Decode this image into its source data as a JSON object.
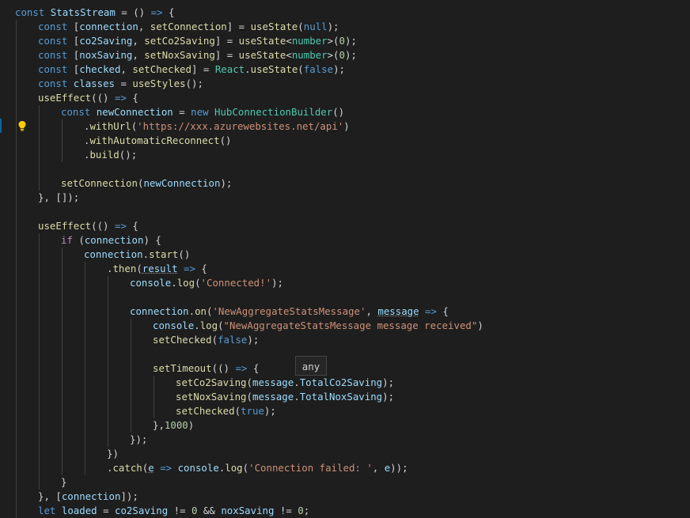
{
  "editor": {
    "lines": [
      {
        "indent": 0,
        "tokens": [
          [
            "k",
            "const"
          ],
          [
            "p",
            " "
          ],
          [
            "v",
            "StatsStream"
          ],
          [
            "p",
            " = () "
          ],
          [
            "k",
            "=>"
          ],
          [
            "p",
            " {"
          ]
        ]
      },
      {
        "indent": 1,
        "tokens": [
          [
            "k",
            "const"
          ],
          [
            "p",
            " ["
          ],
          [
            "v",
            "connection"
          ],
          [
            "p",
            ", "
          ],
          [
            "f",
            "setConnection"
          ],
          [
            "p",
            "] = "
          ],
          [
            "f",
            "useState"
          ],
          [
            "p",
            "("
          ],
          [
            "k",
            "null"
          ],
          [
            "p",
            ");"
          ]
        ]
      },
      {
        "indent": 1,
        "tokens": [
          [
            "k",
            "const"
          ],
          [
            "p",
            " ["
          ],
          [
            "v",
            "co2Saving"
          ],
          [
            "p",
            ", "
          ],
          [
            "f",
            "setCo2Saving"
          ],
          [
            "p",
            "] = "
          ],
          [
            "f",
            "useState"
          ],
          [
            "p",
            "<"
          ],
          [
            "t",
            "number"
          ],
          [
            "p",
            ">("
          ],
          [
            "n",
            "0"
          ],
          [
            "p",
            ");"
          ]
        ]
      },
      {
        "indent": 1,
        "tokens": [
          [
            "k",
            "const"
          ],
          [
            "p",
            " ["
          ],
          [
            "v",
            "noxSaving"
          ],
          [
            "p",
            ", "
          ],
          [
            "f",
            "setNoxSaving"
          ],
          [
            "p",
            "] = "
          ],
          [
            "f",
            "useState"
          ],
          [
            "p",
            "<"
          ],
          [
            "t",
            "number"
          ],
          [
            "p",
            ">("
          ],
          [
            "n",
            "0"
          ],
          [
            "p",
            ");"
          ]
        ]
      },
      {
        "indent": 1,
        "tokens": [
          [
            "k",
            "const"
          ],
          [
            "p",
            " ["
          ],
          [
            "v",
            "checked"
          ],
          [
            "p",
            ", "
          ],
          [
            "f",
            "setChecked"
          ],
          [
            "p",
            "] = "
          ],
          [
            "t",
            "React"
          ],
          [
            "p",
            "."
          ],
          [
            "f",
            "useState"
          ],
          [
            "p",
            "("
          ],
          [
            "k",
            "false"
          ],
          [
            "p",
            ");"
          ]
        ]
      },
      {
        "indent": 1,
        "tokens": [
          [
            "k",
            "const"
          ],
          [
            "p",
            " "
          ],
          [
            "v",
            "classes"
          ],
          [
            "p",
            " = "
          ],
          [
            "f",
            "useStyles"
          ],
          [
            "p",
            "();"
          ]
        ]
      },
      {
        "indent": 1,
        "tokens": [
          [
            "f",
            "useEffect"
          ],
          [
            "p",
            "(() "
          ],
          [
            "k",
            "=>"
          ],
          [
            "p",
            " {"
          ]
        ]
      },
      {
        "indent": 2,
        "tokens": [
          [
            "k",
            "const"
          ],
          [
            "p",
            " "
          ],
          [
            "v",
            "newConnection"
          ],
          [
            "p",
            " = "
          ],
          [
            "k",
            "new"
          ],
          [
            "p",
            " "
          ],
          [
            "t",
            "HubConnectionBuilder"
          ],
          [
            "p",
            "()"
          ]
        ]
      },
      {
        "indent": 3,
        "tokens": [
          [
            "p",
            "."
          ],
          [
            "f",
            "withUrl"
          ],
          [
            "p",
            "("
          ],
          [
            "s",
            "'https://xxx.azurewebsites.net/api'"
          ],
          [
            "p",
            ")"
          ]
        ],
        "active": true
      },
      {
        "indent": 3,
        "tokens": [
          [
            "p",
            "."
          ],
          [
            "f",
            "withAutomaticReconnect"
          ],
          [
            "p",
            "()"
          ]
        ]
      },
      {
        "indent": 3,
        "tokens": [
          [
            "p",
            "."
          ],
          [
            "f",
            "build"
          ],
          [
            "p",
            "();"
          ]
        ]
      },
      {
        "indent": 2,
        "tokens": []
      },
      {
        "indent": 2,
        "tokens": [
          [
            "f",
            "setConnection"
          ],
          [
            "p",
            "("
          ],
          [
            "v",
            "newConnection"
          ],
          [
            "p",
            ");"
          ]
        ]
      },
      {
        "indent": 1,
        "tokens": [
          [
            "p",
            "}, []);"
          ]
        ]
      },
      {
        "indent": 1,
        "tokens": []
      },
      {
        "indent": 1,
        "tokens": [
          [
            "f",
            "useEffect"
          ],
          [
            "p",
            "(() "
          ],
          [
            "k",
            "=>"
          ],
          [
            "p",
            " {"
          ]
        ]
      },
      {
        "indent": 2,
        "tokens": [
          [
            "c",
            "if"
          ],
          [
            "p",
            " ("
          ],
          [
            "v",
            "connection"
          ],
          [
            "p",
            ") {"
          ]
        ]
      },
      {
        "indent": 3,
        "tokens": [
          [
            "v",
            "connection"
          ],
          [
            "p",
            "."
          ],
          [
            "f",
            "start"
          ],
          [
            "p",
            "()"
          ]
        ]
      },
      {
        "indent": 4,
        "tokens": [
          [
            "p",
            "."
          ],
          [
            "f",
            "then"
          ],
          [
            "p",
            "("
          ],
          [
            "v",
            "result"
          ],
          [
            "p",
            " "
          ],
          [
            "k",
            "=>"
          ],
          [
            "p",
            " {"
          ]
        ]
      },
      {
        "indent": 5,
        "tokens": [
          [
            "v",
            "console"
          ],
          [
            "p",
            "."
          ],
          [
            "f",
            "log"
          ],
          [
            "p",
            "("
          ],
          [
            "s",
            "'Connected!'"
          ],
          [
            "p",
            ");"
          ]
        ]
      },
      {
        "indent": 5,
        "tokens": []
      },
      {
        "indent": 5,
        "tokens": [
          [
            "v",
            "connection"
          ],
          [
            "p",
            "."
          ],
          [
            "f",
            "on"
          ],
          [
            "p",
            "("
          ],
          [
            "s",
            "'NewAggregateStatsMessage'"
          ],
          [
            "p",
            ", "
          ],
          [
            "v",
            "message"
          ],
          [
            "p",
            " "
          ],
          [
            "k",
            "=>"
          ],
          [
            "p",
            " {"
          ]
        ]
      },
      {
        "indent": 6,
        "tokens": [
          [
            "v",
            "console"
          ],
          [
            "p",
            "."
          ],
          [
            "f",
            "log"
          ],
          [
            "p",
            "("
          ],
          [
            "s",
            "\"NewAggregateStatsMessage message received\""
          ],
          [
            "p",
            ")"
          ]
        ]
      },
      {
        "indent": 6,
        "tokens": [
          [
            "f",
            "setChecked"
          ],
          [
            "p",
            "("
          ],
          [
            "k",
            "false"
          ],
          [
            "p",
            ");"
          ]
        ]
      },
      {
        "indent": 6,
        "tokens": []
      },
      {
        "indent": 6,
        "tokens": [
          [
            "f",
            "setTimeout"
          ],
          [
            "p",
            "(() "
          ],
          [
            "k",
            "=>"
          ],
          [
            "p",
            " {"
          ]
        ]
      },
      {
        "indent": 7,
        "tokens": [
          [
            "f",
            "setCo2Saving"
          ],
          [
            "p",
            "("
          ],
          [
            "v",
            "message"
          ],
          [
            "p",
            "."
          ],
          [
            "v",
            "TotalCo2Saving"
          ],
          [
            "p",
            ");"
          ]
        ]
      },
      {
        "indent": 7,
        "tokens": [
          [
            "f",
            "setNoxSaving"
          ],
          [
            "p",
            "("
          ],
          [
            "v",
            "message"
          ],
          [
            "p",
            "."
          ],
          [
            "v",
            "TotalNoxSaving"
          ],
          [
            "p",
            ");"
          ]
        ]
      },
      {
        "indent": 7,
        "tokens": [
          [
            "f",
            "setChecked"
          ],
          [
            "p",
            "("
          ],
          [
            "k",
            "true"
          ],
          [
            "p",
            ");"
          ]
        ]
      },
      {
        "indent": 6,
        "tokens": [
          [
            "p",
            "},"
          ],
          [
            "n",
            "1000"
          ],
          [
            "p",
            ")"
          ]
        ]
      },
      {
        "indent": 5,
        "tokens": [
          [
            "p",
            "});"
          ]
        ]
      },
      {
        "indent": 4,
        "tokens": [
          [
            "p",
            "})"
          ]
        ]
      },
      {
        "indent": 4,
        "tokens": [
          [
            "p",
            "."
          ],
          [
            "f",
            "catch"
          ],
          [
            "p",
            "("
          ],
          [
            "v",
            "e"
          ],
          [
            "p",
            " "
          ],
          [
            "k",
            "=>"
          ],
          [
            "p",
            " "
          ],
          [
            "v",
            "console"
          ],
          [
            "p",
            "."
          ],
          [
            "f",
            "log"
          ],
          [
            "p",
            "("
          ],
          [
            "s",
            "'Connection failed: '"
          ],
          [
            "p",
            ", "
          ],
          [
            "v",
            "e"
          ],
          [
            "p",
            "));"
          ]
        ]
      },
      {
        "indent": 2,
        "tokens": [
          [
            "p",
            "}"
          ]
        ]
      },
      {
        "indent": 1,
        "tokens": [
          [
            "p",
            "}, ["
          ],
          [
            "v",
            "connection"
          ],
          [
            "p",
            "]);"
          ]
        ]
      },
      {
        "indent": 1,
        "tokens": [
          [
            "k",
            "let"
          ],
          [
            "p",
            " "
          ],
          [
            "v",
            "loaded"
          ],
          [
            "p",
            " = "
          ],
          [
            "v",
            "co2Saving"
          ],
          [
            "p",
            " != "
          ],
          [
            "n",
            "0"
          ],
          [
            "p",
            " && "
          ],
          [
            "v",
            "noxSaving"
          ],
          [
            "p",
            " != "
          ],
          [
            "n",
            "0"
          ],
          [
            "p",
            ";"
          ]
        ]
      }
    ]
  },
  "hover": {
    "text": "any"
  },
  "icons": {
    "lightbulb": "lightbulb-icon"
  }
}
